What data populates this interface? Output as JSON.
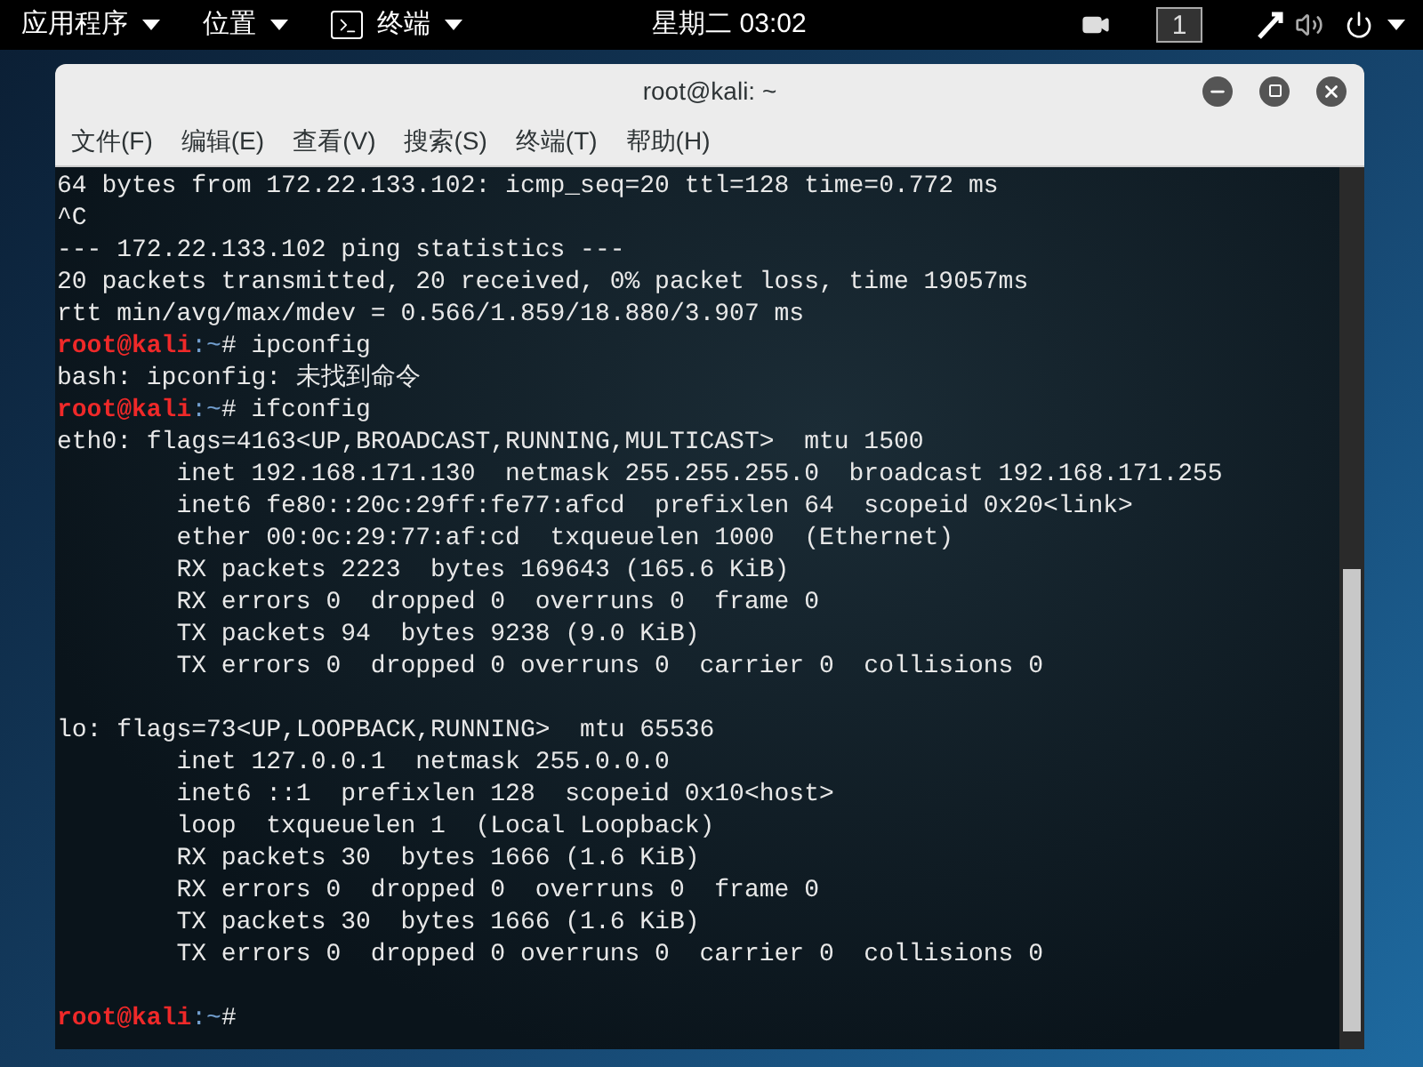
{
  "top_bar": {
    "menus": [
      {
        "label": "应用程序",
        "kind": "text"
      },
      {
        "label": "位置",
        "kind": "text"
      },
      {
        "label": "终端",
        "kind": "terminal"
      }
    ],
    "clock": "星期二 03:02",
    "workspace": "1"
  },
  "window": {
    "title": "root@kali: ~",
    "menu": [
      "文件(F)",
      "编辑(E)",
      "查看(V)",
      "搜索(S)",
      "终端(T)",
      "帮助(H)"
    ]
  },
  "terminal": {
    "lines": [
      {
        "kind": "output",
        "text": "64 bytes from 172.22.133.102: icmp_seq=20 ttl=128 time=0.772 ms"
      },
      {
        "kind": "output",
        "text": "^C"
      },
      {
        "kind": "output",
        "text": "--- 172.22.133.102 ping statistics ---"
      },
      {
        "kind": "output",
        "text": "20 packets transmitted, 20 received, 0% packet loss, time 19057ms"
      },
      {
        "kind": "output",
        "text": "rtt min/avg/max/mdev = 0.566/1.859/18.880/3.907 ms"
      },
      {
        "kind": "prompt",
        "user": "root@kali",
        "path": ":~",
        "command": "# ipconfig"
      },
      {
        "kind": "output",
        "text": "bash: ipconfig: 未找到命令"
      },
      {
        "kind": "prompt",
        "user": "root@kali",
        "path": ":~",
        "command": "# ifconfig"
      },
      {
        "kind": "output",
        "text": "eth0: flags=4163<UP,BROADCAST,RUNNING,MULTICAST>  mtu 1500"
      },
      {
        "kind": "output",
        "text": "        inet 192.168.171.130  netmask 255.255.255.0  broadcast 192.168.171.255"
      },
      {
        "kind": "output",
        "text": "        inet6 fe80::20c:29ff:fe77:afcd  prefixlen 64  scopeid 0x20<link>"
      },
      {
        "kind": "output",
        "text": "        ether 00:0c:29:77:af:cd  txqueuelen 1000  (Ethernet)"
      },
      {
        "kind": "output",
        "text": "        RX packets 2223  bytes 169643 (165.6 KiB)"
      },
      {
        "kind": "output",
        "text": "        RX errors 0  dropped 0  overruns 0  frame 0"
      },
      {
        "kind": "output",
        "text": "        TX packets 94  bytes 9238 (9.0 KiB)"
      },
      {
        "kind": "output",
        "text": "        TX errors 0  dropped 0 overruns 0  carrier 0  collisions 0"
      },
      {
        "kind": "blank"
      },
      {
        "kind": "output",
        "text": "lo: flags=73<UP,LOOPBACK,RUNNING>  mtu 65536"
      },
      {
        "kind": "output",
        "text": "        inet 127.0.0.1  netmask 255.0.0.0"
      },
      {
        "kind": "output",
        "text": "        inet6 ::1  prefixlen 128  scopeid 0x10<host>"
      },
      {
        "kind": "output",
        "text": "        loop  txqueuelen 1  (Local Loopback)"
      },
      {
        "kind": "output",
        "text": "        RX packets 30  bytes 1666 (1.6 KiB)"
      },
      {
        "kind": "output",
        "text": "        RX errors 0  dropped 0  overruns 0  frame 0"
      },
      {
        "kind": "output",
        "text": "        TX packets 30  bytes 1666 (1.6 KiB)"
      },
      {
        "kind": "output",
        "text": "        TX errors 0  dropped 0 overruns 0  carrier 0  collisions 0"
      },
      {
        "kind": "blank"
      },
      {
        "kind": "prompt",
        "user": "root@kali",
        "path": ":~",
        "command": "#"
      }
    ]
  }
}
